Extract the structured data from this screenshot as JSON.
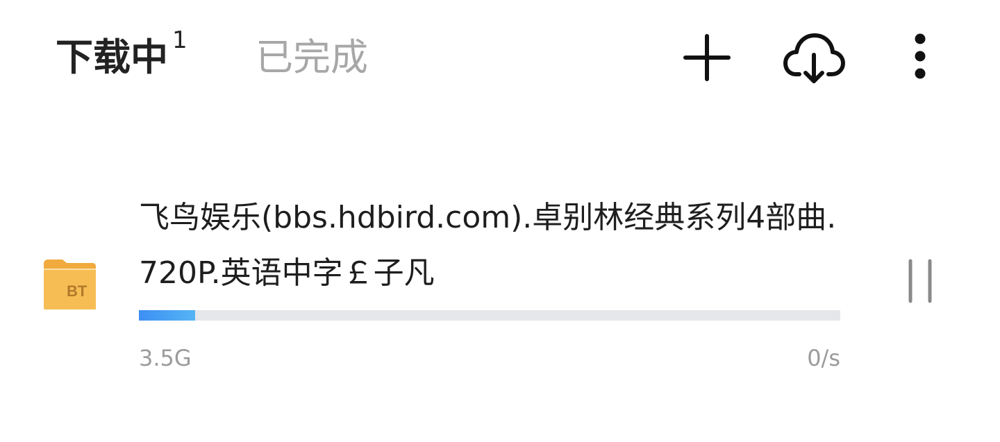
{
  "tabs": {
    "downloading_label": "下载中",
    "downloading_count": "1",
    "completed_label": "已完成"
  },
  "header_icons": [
    "plus-icon",
    "cloud-download-icon",
    "more-vertical-icon"
  ],
  "task": {
    "name": "飞鸟娱乐(bbs.hdbird.com).卓别林经典系列4部曲.720P.英语中字￡子凡",
    "type_badge": "BT",
    "size": "3.5G",
    "speed": "0/s",
    "progress": 0.08,
    "icon": "bt-folder-icon",
    "action_icon": "pause-icon"
  },
  "colors": {
    "progress_fill": "#3d8ff3",
    "progress_track": "#e6e7ea",
    "folder": "#f5b94c",
    "inactive_tab": "#a7a7a7"
  }
}
